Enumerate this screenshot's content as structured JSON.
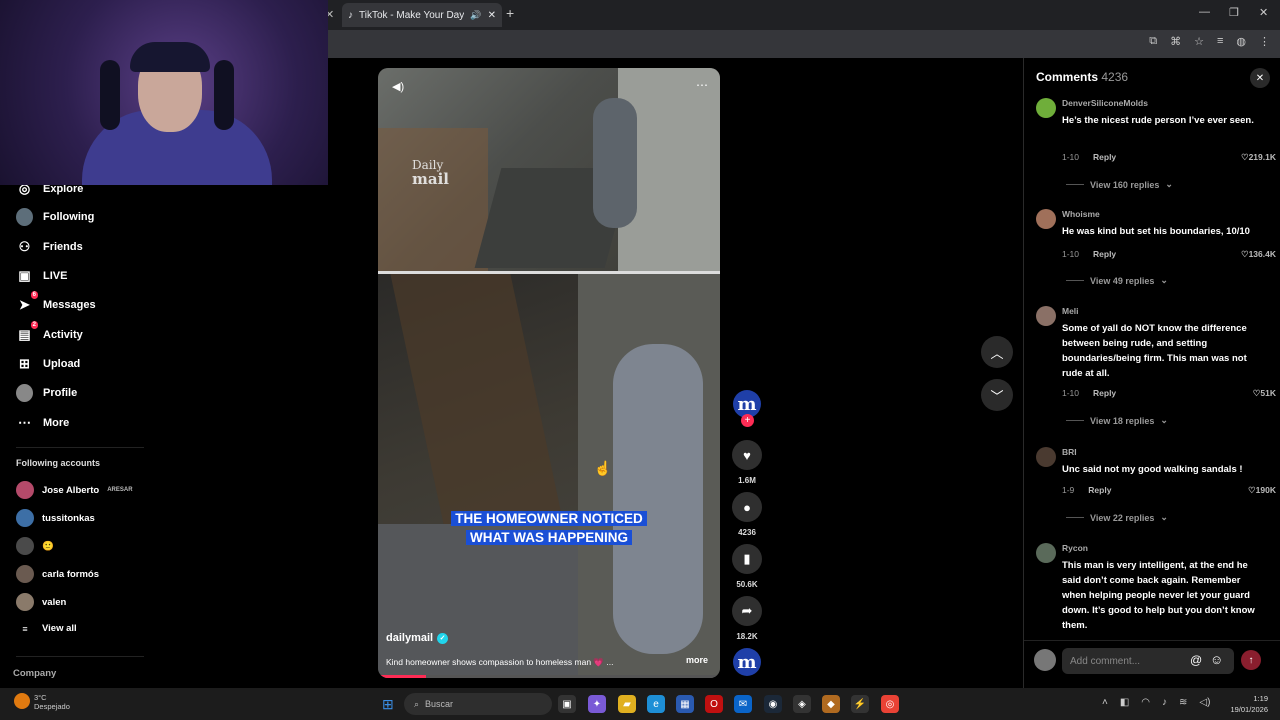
{
  "browser": {
    "tab_title": "TikTok - Make Your Day",
    "tab_close": "✕",
    "left_tab_close": "✕",
    "new_tab": "+",
    "win_min": "—",
    "win_max": "❐",
    "win_close": "✕"
  },
  "sidebar": {
    "nav": [
      {
        "label": "Explore",
        "icon": "compass-icon",
        "glyph": "◎"
      },
      {
        "label": "Following",
        "icon": "following-avatar-icon",
        "glyph": ""
      },
      {
        "label": "Friends",
        "icon": "friends-icon",
        "glyph": "👥"
      },
      {
        "label": "LIVE",
        "icon": "live-icon",
        "glyph": "▣"
      },
      {
        "label": "Messages",
        "icon": "messages-icon",
        "glyph": "➤",
        "badge": "6"
      },
      {
        "label": "Activity",
        "icon": "activity-icon",
        "glyph": "▤",
        "badge": "2"
      },
      {
        "label": "Upload",
        "icon": "upload-icon",
        "glyph": "⊞"
      },
      {
        "label": "Profile",
        "icon": "profile-avatar-icon",
        "glyph": ""
      },
      {
        "label": "More",
        "icon": "more-icon",
        "glyph": "⋯"
      }
    ],
    "following_title": "Following accounts",
    "following": [
      {
        "name": "Jose Alberto",
        "suffix": "ARESAR"
      },
      {
        "name": "tussitonkas",
        "suffix": ""
      },
      {
        "name": "🙂",
        "suffix": ""
      },
      {
        "name": "carla formós",
        "suffix": ""
      },
      {
        "name": "valen",
        "suffix": ""
      }
    ],
    "view_all": "View all",
    "company": "Company"
  },
  "video": {
    "watermark_top": "Daily",
    "watermark_bottom": "mail",
    "caption_line1": "THE HOMEOWNER NOTICED",
    "caption_line2": "WHAT WAS HAPPENING",
    "author": "dailymail",
    "description": "Kind homeowner shows compassion to homeless man 💗 ...",
    "more": "more",
    "progress": 0.14
  },
  "actions": {
    "avatar_letter": "m",
    "likes": "1.6M",
    "comments": "4236",
    "saves": "50.6K",
    "shares": "18.2K"
  },
  "comments": {
    "title": "Comments",
    "count": "4236",
    "items": [
      {
        "user": "DenverSiliconeMolds",
        "text": "He’s the nicest rude person I’ve ever seen.",
        "date": "1-10",
        "reply": "Reply",
        "likes": "219.1K",
        "view": "View 160 replies"
      },
      {
        "user": "Whoisme",
        "text": "He was kind but set his boundaries, 10/10",
        "date": "1-10",
        "reply": "Reply",
        "likes": "136.4K",
        "view": "View 49 replies"
      },
      {
        "user": "Meli",
        "text": "Some of yall do NOT know the difference between being rude, and setting boundaries/being firm. This man was not rude at all.",
        "date": "1-10",
        "reply": "Reply",
        "likes": "51K",
        "view": "View 18 replies"
      },
      {
        "user": "BRI",
        "text": "Unc said not my good walking sandals !",
        "date": "1-9",
        "reply": "Reply",
        "likes": "190K",
        "view": "View 22 replies"
      },
      {
        "user": "Rycon",
        "text": "This man is very intelligent, at the end he said don’t come back again. Remember when helping people never let your guard down. It’s good to help but you don’t know them.",
        "date": "",
        "reply": "",
        "likes": "",
        "view": ""
      }
    ],
    "input_placeholder": "Add comment..."
  },
  "taskbar": {
    "weather_temp": "3°C",
    "weather_desc": "Despejado",
    "search_placeholder": "Buscar",
    "time": "1:19",
    "date": "19/01/2026"
  }
}
